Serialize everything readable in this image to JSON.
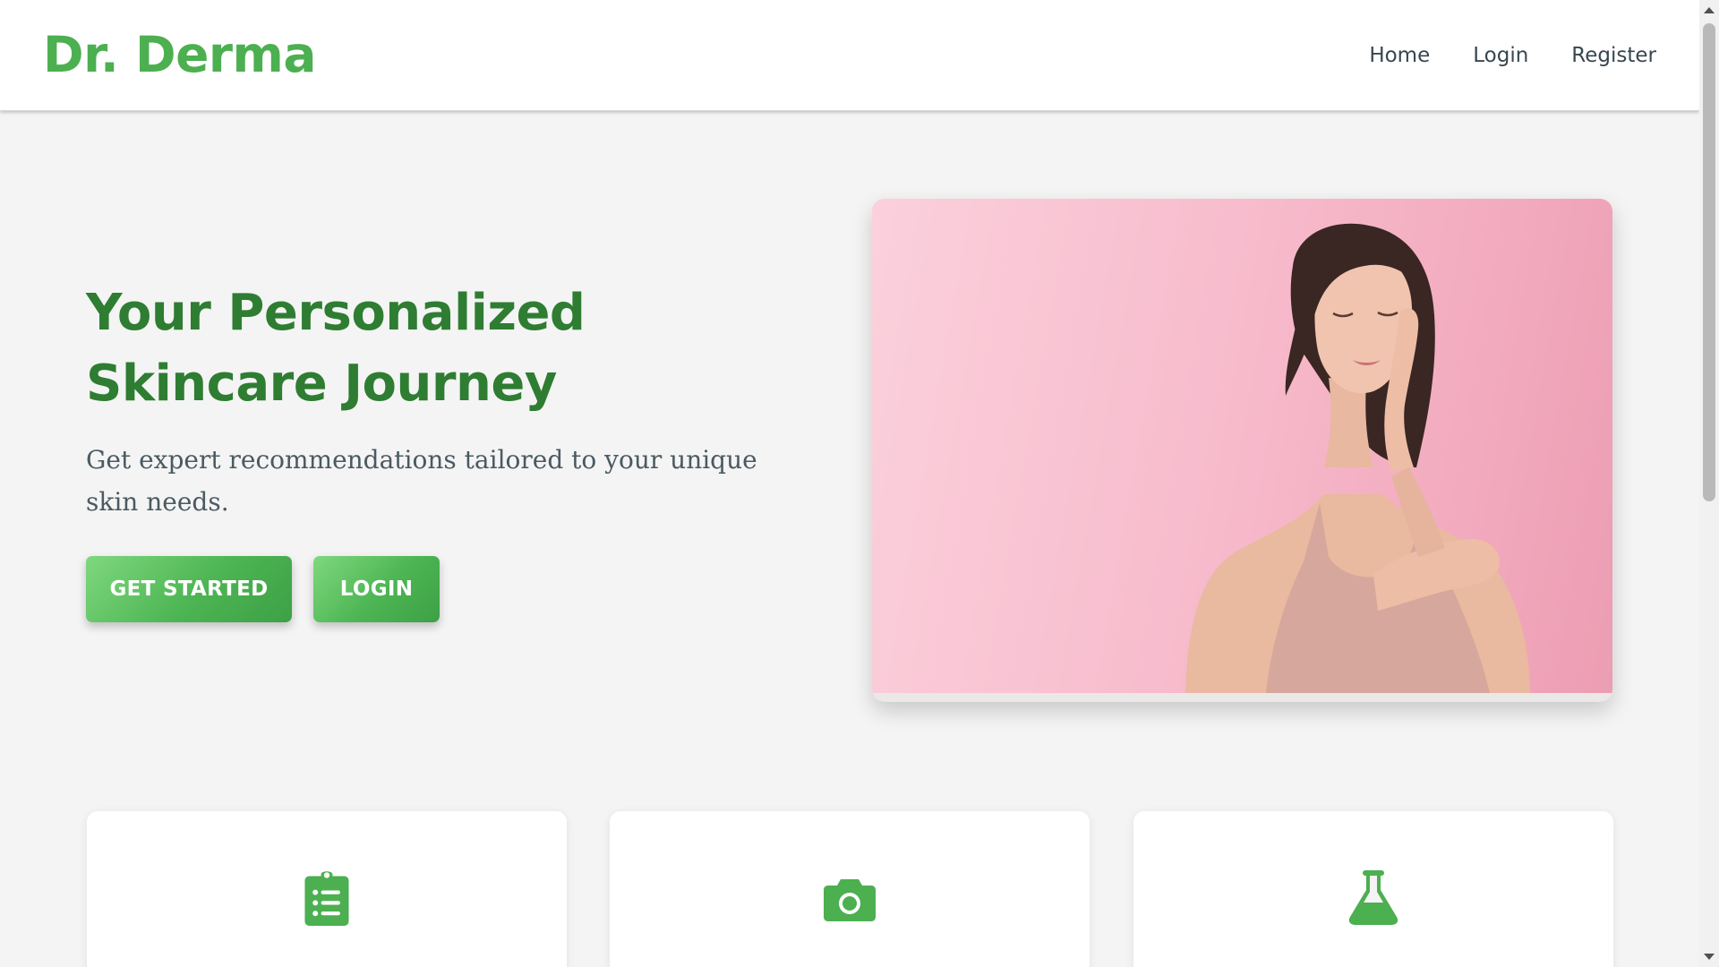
{
  "header": {
    "brand": "Dr. Derma",
    "nav": {
      "home": "Home",
      "login": "Login",
      "register": "Register"
    }
  },
  "hero": {
    "title_line1": "Your Personalized",
    "title_line2": "Skincare Journey",
    "subtitle": "Get expert recommendations tailored to your unique skin needs.",
    "get_started_label": "GET STARTED",
    "login_label": "LOGIN",
    "image_alt": "woman-touching-face-skincare"
  },
  "features": {
    "icons": [
      "clipboard-list-icon",
      "camera-icon",
      "flask-icon"
    ]
  },
  "colors": {
    "brand": "#4caf50",
    "heading": "#2e7d32",
    "nav_text": "#37474f",
    "page_bg": "#f4f4f4",
    "hero_image_bg": "#f7bccd"
  }
}
